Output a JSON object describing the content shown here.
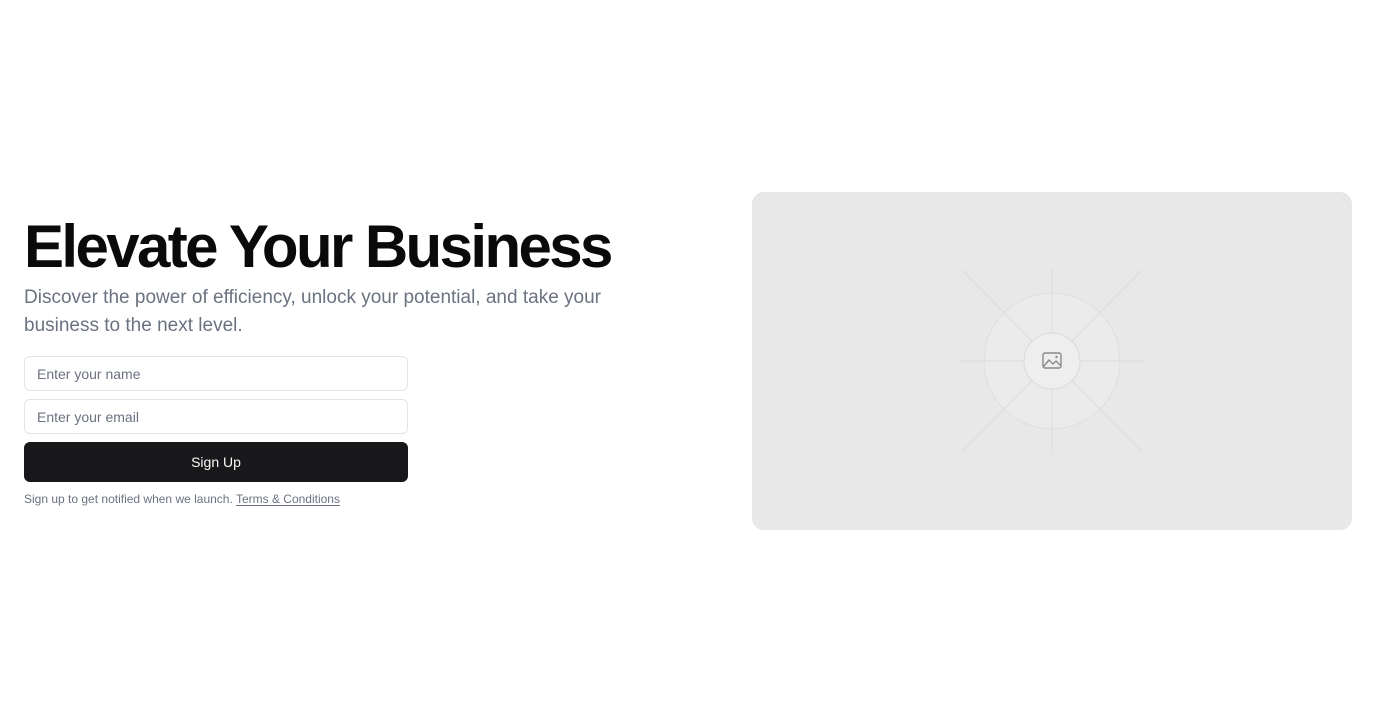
{
  "hero": {
    "title": "Elevate Your Business",
    "subtitle": "Discover the power of efficiency, unlock your potential, and take your business to the next level."
  },
  "form": {
    "name_placeholder": "Enter your name",
    "email_placeholder": "Enter your email",
    "submit_label": "Sign Up",
    "note": "Sign up to get notified when we launch.",
    "terms_link": "Terms & Conditions"
  },
  "placeholder_image": {
    "icon": "image-icon"
  },
  "colors": {
    "button_bg": "#18181b",
    "button_text": "#fafafa",
    "muted_text": "#6b7280",
    "placeholder_bg": "#e8e8e8"
  }
}
